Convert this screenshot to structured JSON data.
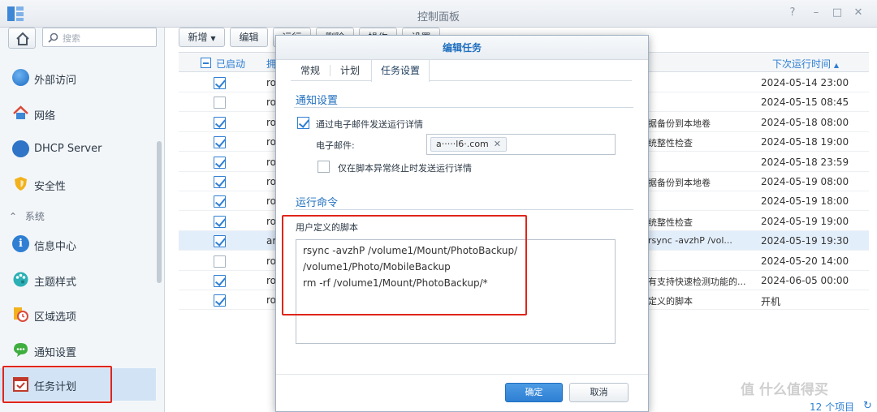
{
  "window": {
    "title": "控制面板"
  },
  "sidebar": {
    "search_placeholder": "搜索",
    "items": [
      {
        "label": "外部访问",
        "icon": "globe-icon"
      },
      {
        "label": "网络",
        "icon": "network-house-icon"
      },
      {
        "label": "DHCP Server",
        "icon": "dhcp-icon"
      },
      {
        "label": "安全性",
        "icon": "shield-icon"
      },
      {
        "label": "信息中心",
        "icon": "info-icon"
      },
      {
        "label": "主题样式",
        "icon": "palette-icon"
      },
      {
        "label": "区域选项",
        "icon": "region-clock-icon"
      },
      {
        "label": "通知设置",
        "icon": "chat-bubble-icon"
      },
      {
        "label": "任务计划",
        "icon": "calendar-check-icon"
      }
    ],
    "section_system": "系统",
    "active_item": "任务计划"
  },
  "toolbar": {
    "create_label": "新增",
    "edit_label": "编辑",
    "run_label": "运行",
    "delete_label": "删除",
    "action_label": "操作",
    "settings_label": "设置"
  },
  "table": {
    "headers": {
      "enabled": "已启动",
      "owner": "拥",
      "next_run": "下次运行时间"
    },
    "rows": [
      {
        "enabled": true,
        "owner": "ro",
        "task": "",
        "next_run": "2024-05-14 23:00"
      },
      {
        "enabled": false,
        "owner": "ro",
        "task": "",
        "next_run": "2024-05-15 08:45"
      },
      {
        "enabled": true,
        "owner": "ro",
        "task": "据备份到本地卷",
        "next_run": "2024-05-18 08:00"
      },
      {
        "enabled": true,
        "owner": "ro",
        "task": "统整性检查",
        "next_run": "2024-05-18 19:00"
      },
      {
        "enabled": true,
        "owner": "ro",
        "task": "",
        "next_run": "2024-05-18 23:59"
      },
      {
        "enabled": true,
        "owner": "ro",
        "task": "据备份到本地卷",
        "next_run": "2024-05-19 08:00"
      },
      {
        "enabled": true,
        "owner": "ro",
        "task": "",
        "next_run": "2024-05-19 18:00"
      },
      {
        "enabled": true,
        "owner": "ro",
        "task": "统整性检查",
        "next_run": "2024-05-19 19:00"
      },
      {
        "enabled": true,
        "owner": "ar",
        "task": "rsync -avzhP /vol...",
        "next_run": "2024-05-19 19:30",
        "selected": true
      },
      {
        "enabled": false,
        "owner": "ro",
        "task": "",
        "next_run": "2024-05-20 14:00"
      },
      {
        "enabled": true,
        "owner": "ro",
        "task": "有支持快速检测功能的...",
        "next_run": "2024-06-05 00:00"
      },
      {
        "enabled": true,
        "owner": "ro",
        "task": "定义的脚本",
        "next_run": "开机"
      }
    ],
    "item_count": "12 个项目"
  },
  "dialog": {
    "title": "编辑任务",
    "tabs": [
      "常规",
      "计划",
      "任务设置"
    ],
    "active_tab": "任务设置",
    "notify_section": "通知设置",
    "send_email_label": "通过电子邮件发送运行详情",
    "send_email_checked": true,
    "email_label": "电子邮件:",
    "email_value": "a·····l6·.com",
    "only_abnormal_label": "仅在脚本异常终止时发送运行详情",
    "only_abnormal_checked": false,
    "command_section": "运行命令",
    "script_label": "用户定义的脚本",
    "script_lines": [
      "rsync -avzhP /volume1/Mount/PhotoBackup/",
      "/volume1/Photo/MobileBackup",
      "rm -rf /volume1/Mount/PhotoBackup/*"
    ],
    "ok_label": "确定",
    "cancel_label": "取消"
  },
  "watermark": "值 什么值得买",
  "colors": {
    "accent": "#2f7fd3",
    "highlight_border": "#e0251b",
    "active_nav": "#d1e3f5"
  }
}
